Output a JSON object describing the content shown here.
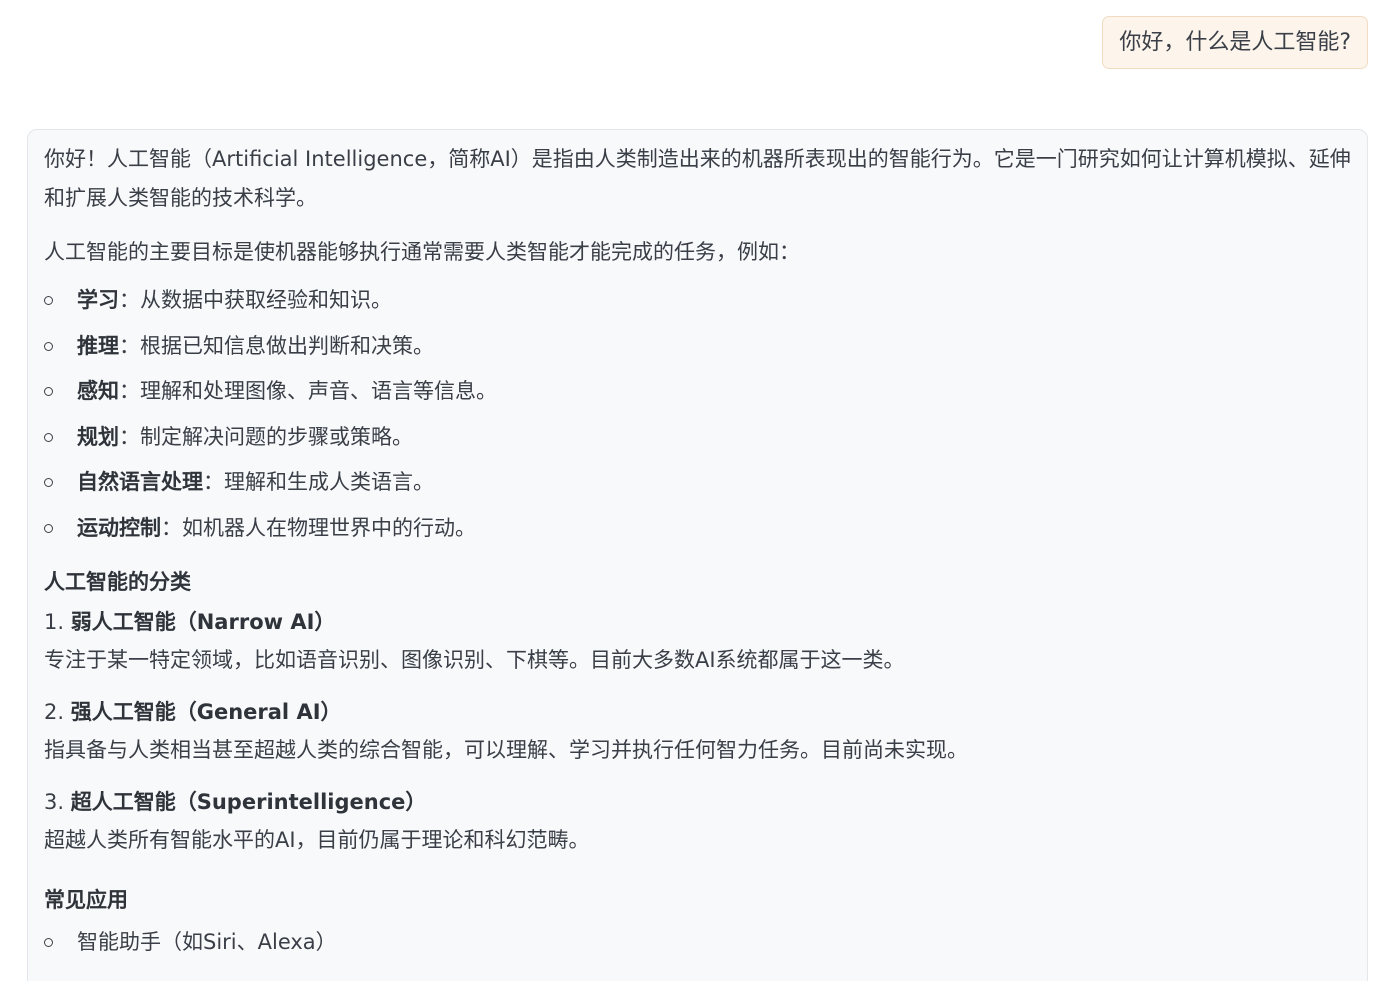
{
  "user_message": "你好，什么是人工智能?",
  "assistant": {
    "intro": "你好！人工智能（Artificial Intelligence，简称AI）是指由人类制造出来的机器所表现出的智能行为。它是一门研究如何让计算机模拟、延伸和扩展人类智能的技术科学。",
    "goals_lead": "人工智能的主要目标是使机器能够执行通常需要人类智能才能完成的任务，例如：",
    "goals": [
      {
        "term": "学习",
        "desc": "：从数据中获取经验和知识。"
      },
      {
        "term": "推理",
        "desc": "：根据已知信息做出判断和决策。"
      },
      {
        "term": "感知",
        "desc": "：理解和处理图像、声音、语言等信息。"
      },
      {
        "term": "规划",
        "desc": "：制定解决问题的步骤或策略。"
      },
      {
        "term": "自然语言处理",
        "desc": "：理解和生成人类语言。"
      },
      {
        "term": "运动控制",
        "desc": "：如机器人在物理世界中的行动。"
      }
    ],
    "categories_heading": "人工智能的分类",
    "categories": [
      {
        "num": "1.",
        "title": "弱人工智能（Narrow AI）",
        "desc": "专注于某一特定领域，比如语音识别、图像识别、下棋等。目前大多数AI系统都属于这一类。"
      },
      {
        "num": "2.",
        "title": "强人工智能（General AI）",
        "desc": "指具备与人类相当甚至超越人类的综合智能，可以理解、学习并执行任何智力任务。目前尚未实现。"
      },
      {
        "num": "3.",
        "title": "超人工智能（Superintelligence）",
        "desc": "超越人类所有智能水平的AI，目前仍属于理论和科幻范畴。"
      }
    ],
    "apps_heading": "常见应用",
    "apps": [
      "智能助手（如Siri、Alexa）"
    ]
  }
}
